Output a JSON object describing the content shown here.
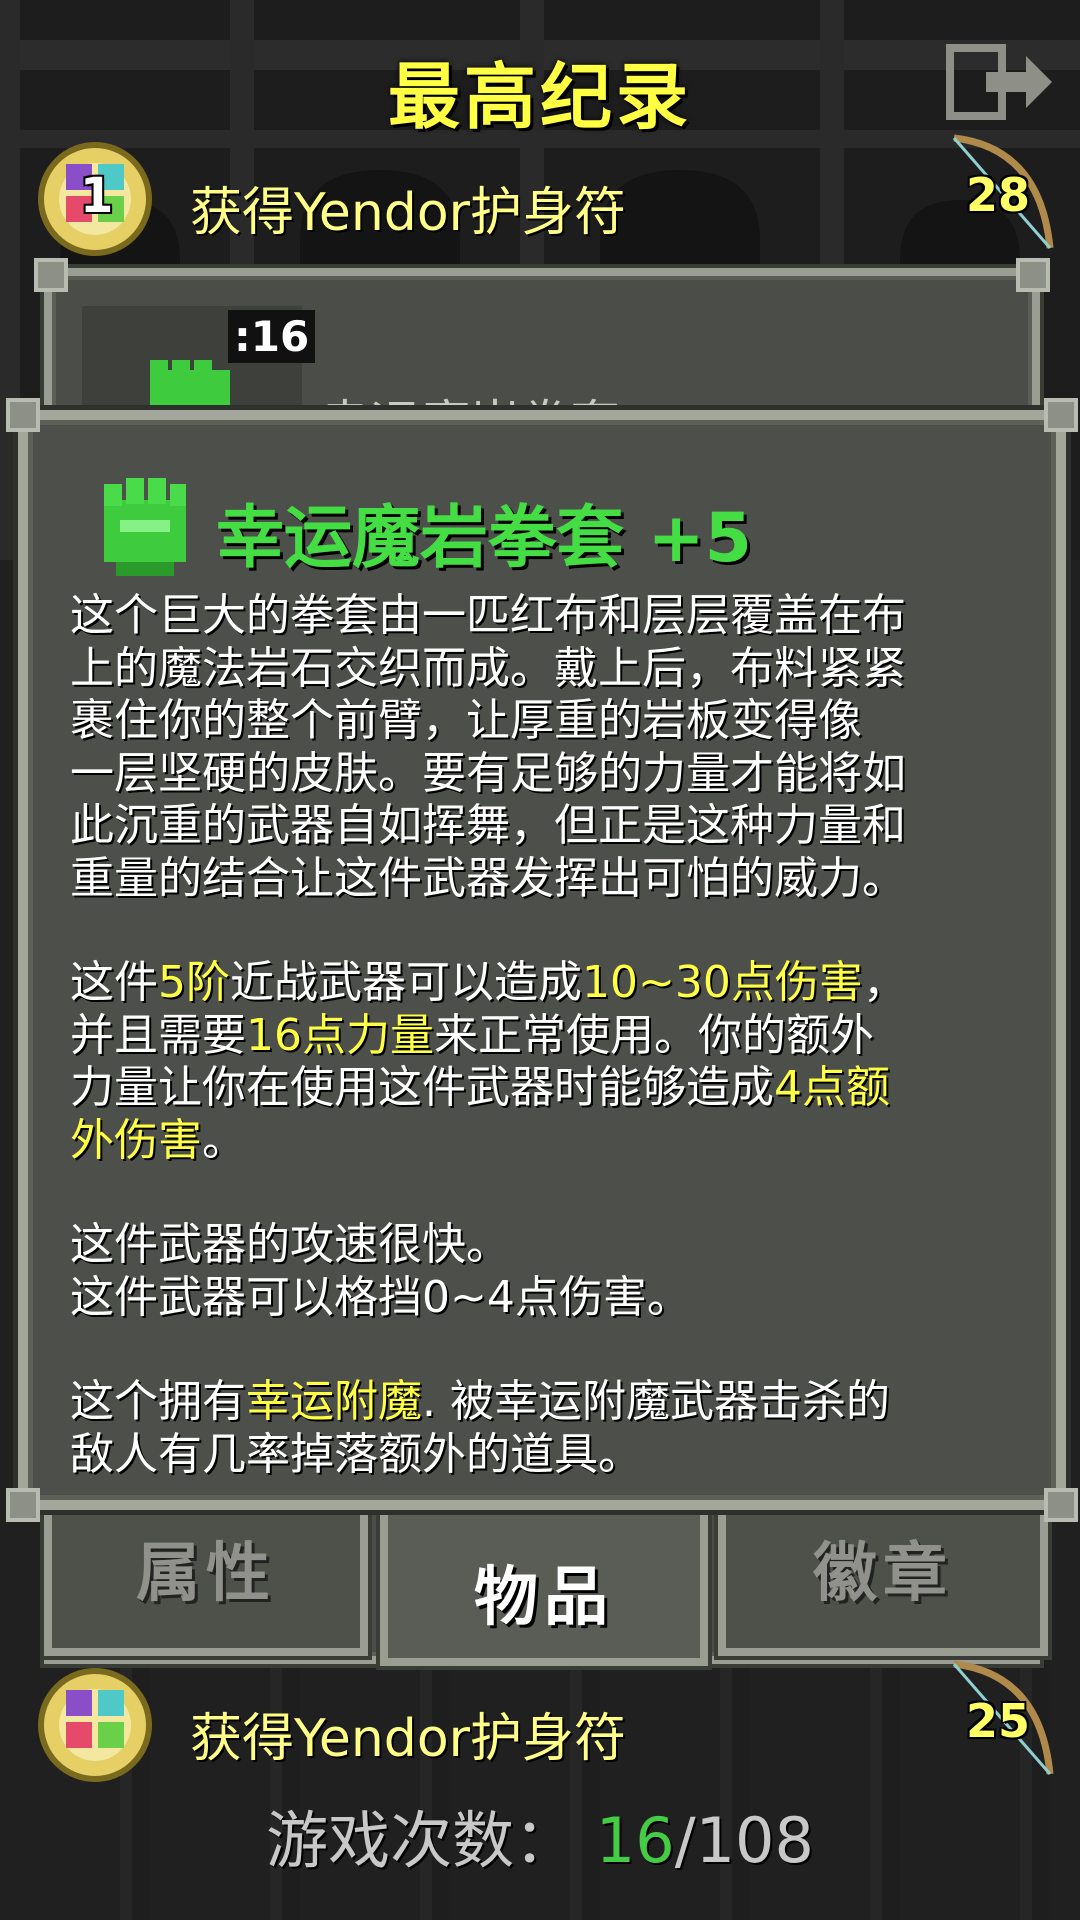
{
  "screen": {
    "title": "最高纪录"
  },
  "records": [
    {
      "rank": "1",
      "description": "获得Yendor护身符",
      "depth": "28",
      "badge_icon": "amulet-badge-icon",
      "class_icon": "bow-icon"
    },
    {
      "rank": "",
      "description": "获得Yendor护身符",
      "depth": "25",
      "badge_icon": "amulet-badge-icon",
      "class_icon": "bow-icon"
    }
  ],
  "back_panel": {
    "timer": ":16",
    "item_name_partial": "幸运魔岩拳套"
  },
  "tabs": [
    {
      "label": "属性",
      "active": false
    },
    {
      "label": "物品",
      "active": true
    },
    {
      "label": "徽章",
      "active": false
    }
  ],
  "item_window": {
    "icon": "gauntlet-icon",
    "name": "幸运魔岩拳套 +5",
    "description_lines": [
      "这个巨大的拳套由一匹红布和层层覆盖在布",
      "上的魔法岩石交织而成。戴上后，布料紧紧",
      "裹住你的整个前臂，让厚重的岩板变得像",
      "一层坚硬的皮肤。要有足够的力量才能将如",
      "此沉重的武器自如挥舞，但正是这种力量和",
      "重量的结合让这件武器发挥出可怕的威力。"
    ],
    "stats": {
      "line1_pre": "这件",
      "tier": "5阶",
      "line1_mid": "近战武器可以造成",
      "damage": "10~30点伤害",
      "line1_post": "，",
      "line2_pre": "并且需要",
      "strength": "16点力量",
      "line2_post": "来正常使用。你的额外",
      "line3_pre": "力量让你在使用这件武器时能够造成",
      "bonus_a": "4点额",
      "bonus_b": "外伤害",
      "line4_post": "。"
    },
    "speed_line": "这件武器的攻速很快。",
    "block_line": "这件武器可以格挡0~4点伤害。",
    "enchant": {
      "pre": "这个拥有",
      "name": "幸运附魔",
      "post": ". 被幸运附魔武器击杀的",
      "line2": "敌人有几率掉落额外的道具。"
    }
  },
  "footer": {
    "label": "游戏次数：",
    "wins": "16",
    "separator": "/",
    "total": "108"
  },
  "colors": {
    "title": "#ffff44",
    "item_name": "#44dd44",
    "highlight": "#ffff44",
    "wins": "#44cc44",
    "panel_bg": "#4d504a",
    "panel_border": "#a3a69b"
  }
}
